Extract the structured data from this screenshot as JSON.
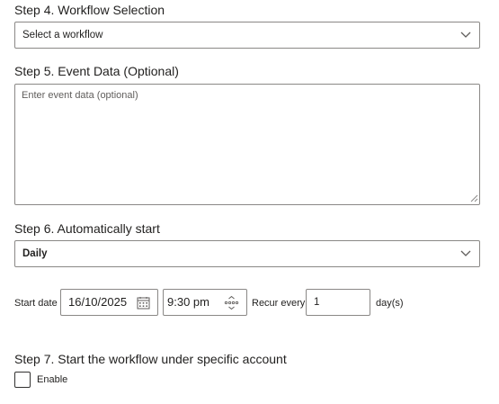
{
  "step4": {
    "heading": "Step 4. Workflow Selection",
    "select_value": "Select a workflow"
  },
  "step5": {
    "heading": "Step 5. Event Data (Optional)",
    "placeholder": "Enter event data (optional)"
  },
  "step6": {
    "heading": "Step 6. Automatically start",
    "select_value": "Daily",
    "start_date_label": "Start date",
    "start_date_value": "16/10/2025",
    "time_value": "9:30 pm",
    "recur_label": "Recur every",
    "recur_value": "1",
    "recur_unit": "day(s)"
  },
  "step7": {
    "heading": "Step 7. Start the workflow under specific account",
    "enable_label": "Enable",
    "enable_checked": false
  },
  "icons": {
    "dropdown": "chevron-down-icon",
    "calendar": "calendar-icon",
    "time_spinner": "time-spinner-icon",
    "resize": "resize-grip-icon"
  }
}
